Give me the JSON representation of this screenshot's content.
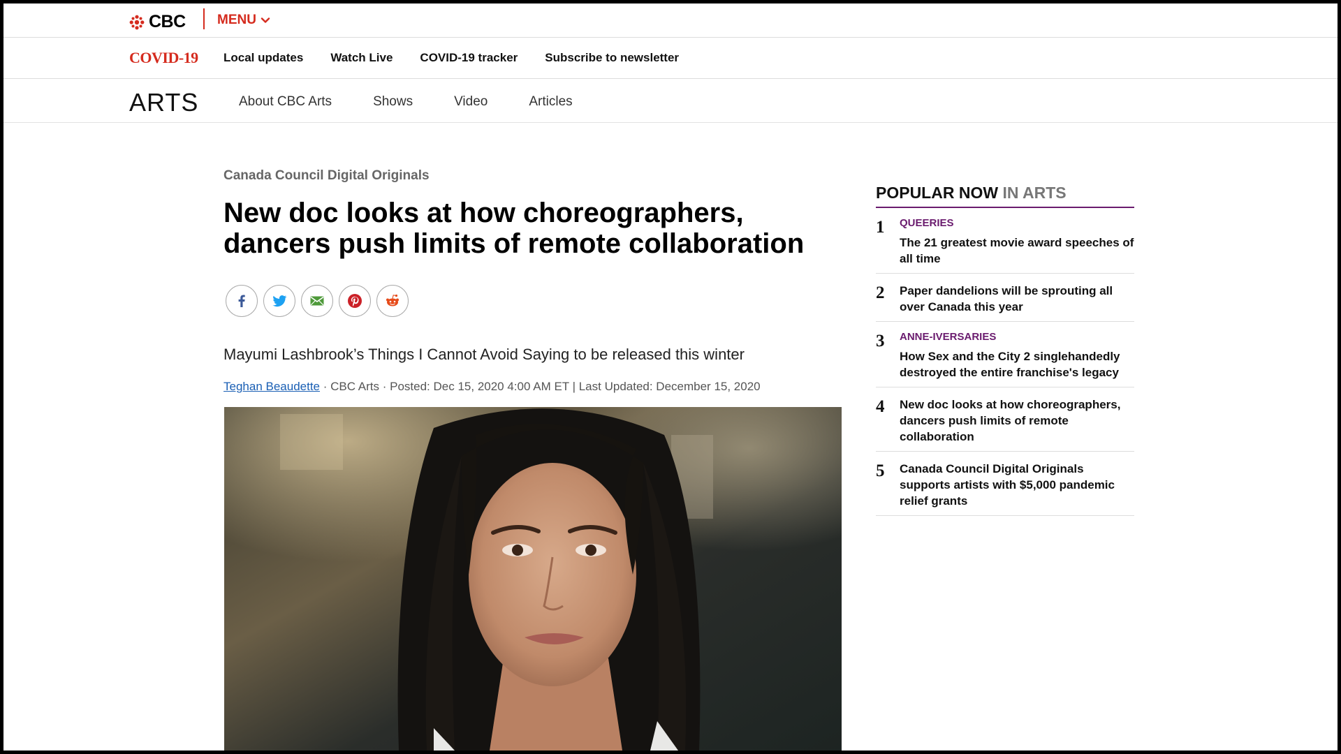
{
  "header": {
    "logo_text": "CBC",
    "menu_label": "MENU",
    "covid_label": "COVID-19",
    "covid_links": [
      "Local updates",
      "Watch Live",
      "COVID-19 tracker",
      "Subscribe to newsletter"
    ],
    "section_title": "ARTS",
    "section_links": [
      "About CBC Arts",
      "Shows",
      "Video",
      "Articles"
    ]
  },
  "article": {
    "eyebrow": "Canada Council Digital Originals",
    "headline": "New doc looks at how choreographers, dancers push limits of remote collaboration",
    "share_icons": [
      "facebook-icon",
      "twitter-icon",
      "email-icon",
      "pinterest-icon",
      "reddit-icon"
    ],
    "deck": "Mayumi Lashbrook’s Things I Cannot Avoid Saying to be released this winter",
    "byline": {
      "author": "Teghan Beaudette",
      "rest": " · CBC Arts · Posted: Dec 15, 2020 4:00 AM ET | Last Updated: December 15, 2020"
    }
  },
  "popular": {
    "title": "POPULAR NOW",
    "title_suffix": " IN ARTS",
    "items": [
      {
        "num": "1",
        "kicker": "QUEERIES",
        "headline": "The 21 greatest movie award speeches of all time"
      },
      {
        "num": "2",
        "kicker": "",
        "headline": "Paper dandelions will be sprouting all over Canada this year"
      },
      {
        "num": "3",
        "kicker": "ANNE-IVERSARIES",
        "headline": "How Sex and the City 2 singlehandedly destroyed the entire franchise's legacy"
      },
      {
        "num": "4",
        "kicker": "",
        "headline": "New doc looks at how choreographers, dancers push limits of remote collaboration"
      },
      {
        "num": "5",
        "kicker": "",
        "headline": "Canada Council Digital Originals supports artists with $5,000 pandemic relief grants"
      }
    ]
  },
  "colors": {
    "brand_red": "#d52b1e",
    "accent_purple": "#6a1b6e",
    "link_blue": "#1a5fb4"
  }
}
